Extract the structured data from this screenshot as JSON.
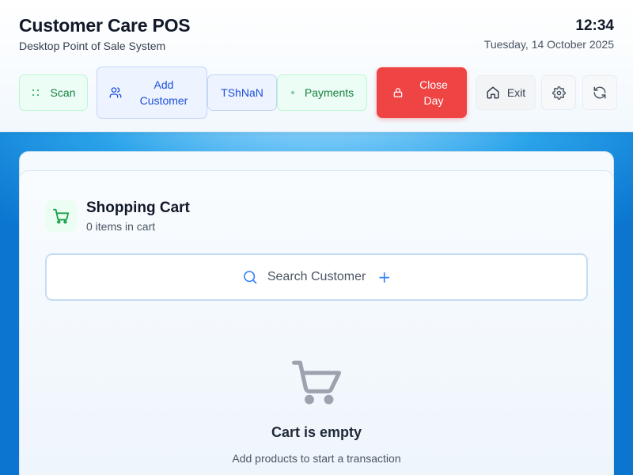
{
  "header": {
    "title": "Customer Care POS",
    "subtitle": "Desktop Point of Sale System",
    "time": "12:34",
    "date": "Tuesday, 14 October 2025"
  },
  "toolbar": {
    "scan": {
      "label": "Scan",
      "icon": "scan-icon"
    },
    "add_customer": {
      "label": "Add Customer",
      "icon": "users-icon"
    },
    "currency": {
      "label": "TShNaN"
    },
    "payments": {
      "label": "Payments",
      "icon": "payments-icon"
    },
    "close_day": {
      "label": "Close Day",
      "icon": "lock-icon"
    },
    "exit": {
      "label": "Exit",
      "icon": "home-icon"
    },
    "settings": {
      "icon": "gear-icon"
    },
    "refresh": {
      "icon": "refresh-icon"
    }
  },
  "cart": {
    "title": "Shopping Cart",
    "count_text": "0 items in cart",
    "icon": "cart-icon",
    "search": {
      "label": "Search Customer",
      "icon": "search-icon",
      "add_icon": "plus-icon"
    },
    "empty": {
      "icon": "cart-icon",
      "title": "Cart is empty",
      "subtitle": "Add products to start a transaction"
    }
  },
  "colors": {
    "green_accent": "#16a34a",
    "blue_accent": "#1d4ed8",
    "danger": "#ef4444",
    "background_blue": "#1b8fe0"
  }
}
